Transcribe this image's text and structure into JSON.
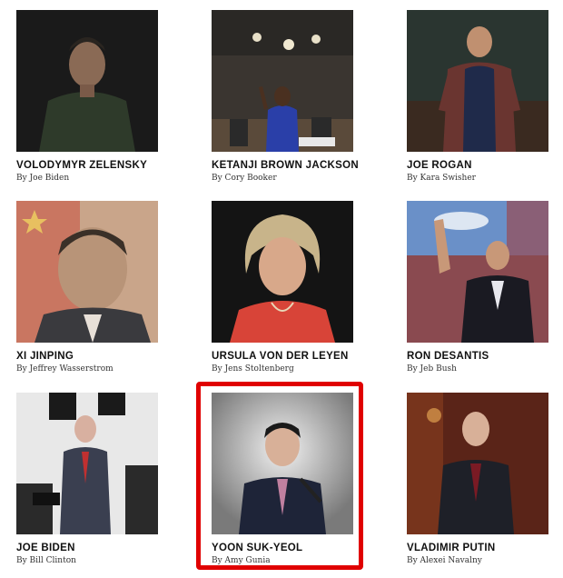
{
  "highlight_color": "#e00000",
  "cards": [
    {
      "name": "VOLODYMYR ZELENSKY",
      "byline": "By Joe Biden",
      "image": "portrait-photo"
    },
    {
      "name": "KETANJI BROWN JACKSON",
      "byline": "By Cory Booker",
      "image": "portrait-photo"
    },
    {
      "name": "JOE ROGAN",
      "byline": "By Kara Swisher",
      "image": "portrait-photo"
    },
    {
      "name": "XI JINPING",
      "byline": "By Jeffrey Wasserstrom",
      "image": "portrait-photo"
    },
    {
      "name": "URSULA VON DER LEYEN",
      "byline": "By Jens Stoltenberg",
      "image": "portrait-photo"
    },
    {
      "name": "RON DESANTIS",
      "byline": "By Jeb Bush",
      "image": "portrait-photo"
    },
    {
      "name": "JOE BIDEN",
      "byline": "By Bill Clinton",
      "image": "portrait-photo"
    },
    {
      "name": "YOON SUK-YEOL",
      "byline": "By Amy Gunia",
      "image": "portrait-photo",
      "highlighted": true
    },
    {
      "name": "VLADIMIR PUTIN",
      "byline": "By Alexei Navalny",
      "image": "portrait-photo"
    }
  ]
}
